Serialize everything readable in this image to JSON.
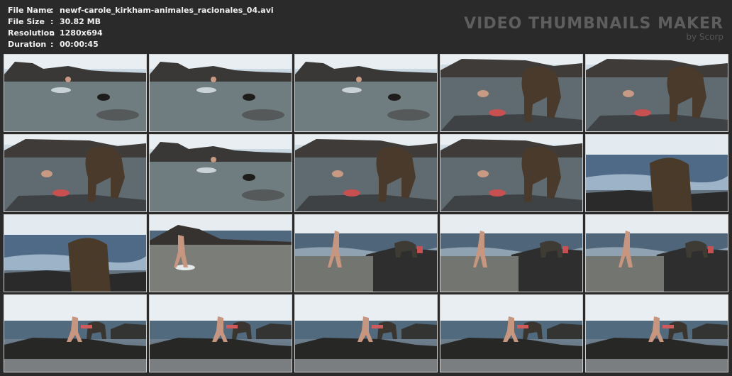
{
  "info": {
    "file_name": {
      "label": "File Name",
      "value": "newf-carole_kirkham-animales_racionales_04.avi"
    },
    "file_size": {
      "label": "File Size",
      "value": "30.82 MB"
    },
    "resolution": {
      "label": "Resolution",
      "value": "1280x694"
    },
    "duration": {
      "label": "Duration",
      "value": "00:00:45"
    },
    "separator": ":"
  },
  "brand": {
    "title": "VIDEO THUMBNAILS MAKER",
    "subtitle": "by Scorp"
  },
  "thumbnails": [
    {
      "scene": "pool-rocks-far"
    },
    {
      "scene": "pool-rocks-far"
    },
    {
      "scene": "pool-rocks-far"
    },
    {
      "scene": "pool-dog-near"
    },
    {
      "scene": "pool-dog-near"
    },
    {
      "scene": "pool-dog-near"
    },
    {
      "scene": "pool-rocks-far"
    },
    {
      "scene": "pool-dog-near"
    },
    {
      "scene": "pool-dog-near"
    },
    {
      "scene": "sea-dog-close"
    },
    {
      "scene": "sea-dog-close"
    },
    {
      "scene": "pool-person"
    },
    {
      "scene": "shore-dog"
    },
    {
      "scene": "shore-dog"
    },
    {
      "scene": "shore-dog"
    },
    {
      "scene": "rock-top"
    },
    {
      "scene": "rock-top"
    },
    {
      "scene": "rock-top"
    },
    {
      "scene": "rock-top"
    },
    {
      "scene": "rock-top"
    }
  ]
}
